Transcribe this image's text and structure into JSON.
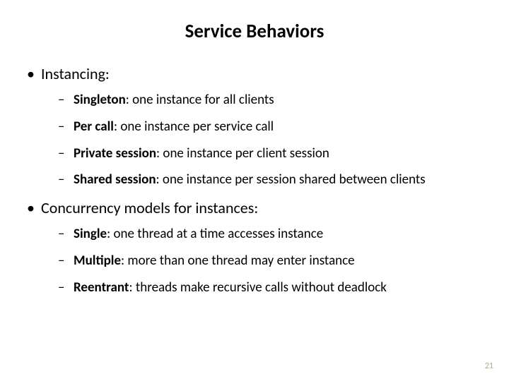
{
  "title": "Service Behaviors",
  "sections": [
    {
      "heading": "Instancing:",
      "items": [
        {
          "term": "Singleton",
          "desc": ": one instance for all clients"
        },
        {
          "term": "Per call",
          "desc": ": one instance per service call"
        },
        {
          "term": "Private session",
          "desc": ": one instance per client session"
        },
        {
          "term": "Shared session",
          "desc": ": one instance per session shared between clients"
        }
      ]
    },
    {
      "heading": "Concurrency models for instances:",
      "items": [
        {
          "term": "Single",
          "desc": ": one thread at a time accesses instance"
        },
        {
          "term": "Multiple",
          "desc": ": more than one thread may enter instance"
        },
        {
          "term": "Reentrant",
          "desc": ": threads make recursive calls without deadlock"
        }
      ]
    }
  ],
  "page_number": "21"
}
